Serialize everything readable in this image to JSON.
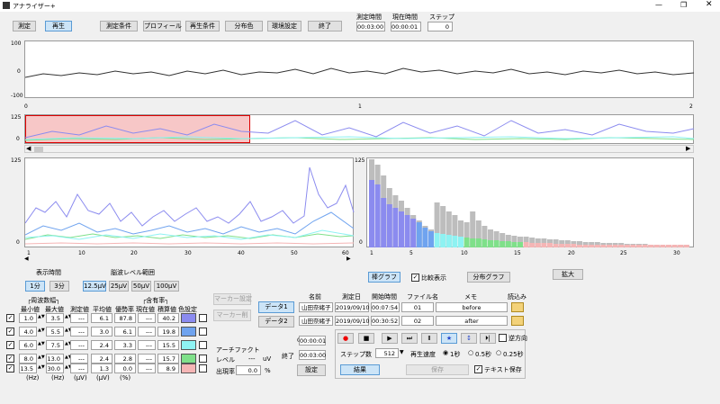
{
  "app": {
    "title": "アナライザー+"
  },
  "topbar": {
    "mode_measure": "測定",
    "mode_playback": "再生",
    "buttons": [
      "測定条件",
      "プロフィール",
      "再生条件",
      "分布色",
      "環境設定",
      "終了"
    ],
    "measure_time_label": "測定時間",
    "measure_time_value": "00:03:00",
    "current_time_label": "現在時間",
    "current_time_value": "00:00:01",
    "step_label": "ステップ",
    "step_value": "0"
  },
  "top_chart": {
    "y_ticks": [
      "100",
      "0",
      "-100"
    ],
    "x_ticks": [
      "0",
      "1",
      "2"
    ]
  },
  "overview_chart": {
    "y_ticks": [
      "125",
      "0"
    ]
  },
  "left_chart": {
    "y_ticks": [
      "125",
      "0"
    ],
    "x_ticks": [
      "1",
      "10",
      "20",
      "30",
      "40",
      "50",
      "60"
    ]
  },
  "right_chart": {
    "y_ticks": [
      "125",
      "0"
    ],
    "x_ticks": [
      "1",
      "5",
      "10",
      "15",
      "20",
      "25",
      "30"
    ]
  },
  "display_time": {
    "label": "表示時間",
    "options": [
      "1分",
      "3分"
    ]
  },
  "eeg_range": {
    "label": "脳波レベル範囲",
    "options": [
      "12.5μV",
      "25μV",
      "50μV",
      "100μV"
    ]
  },
  "freq_table": {
    "group_label": "┌周波数幅┐",
    "content_label": "┌含有率┐",
    "headers": [
      "最小値",
      "最大値",
      "測定値",
      "平均値",
      "優勢率",
      "現在値",
      "積算値",
      "色設定"
    ],
    "units": [
      "(Hz)",
      "(Hz)",
      "(μV)",
      "(μV)",
      "(%)"
    ],
    "rows": [
      {
        "min": "1.0",
        "max": "3.5",
        "measured": "---",
        "avg": "6.1",
        "dominance": "87.8",
        "current": "---",
        "cumulative": "40.2",
        "color": "#8b8bef"
      },
      {
        "min": "4.0",
        "max": "5.5",
        "measured": "---",
        "avg": "3.0",
        "dominance": "6.1",
        "current": "---",
        "cumulative": "19.8",
        "color": "#6fa3ef"
      },
      {
        "min": "6.0",
        "max": "7.5",
        "measured": "---",
        "avg": "2.4",
        "dominance": "3.3",
        "current": "---",
        "cumulative": "15.5",
        "color": "#8ef2f2"
      },
      {
        "min": "8.0",
        "max": "13.0",
        "measured": "---",
        "avg": "2.4",
        "dominance": "2.8",
        "current": "---",
        "cumulative": "15.7",
        "color": "#7fe08a"
      },
      {
        "min": "13.5",
        "max": "30.0",
        "measured": "---",
        "avg": "1.3",
        "dominance": "0.0",
        "current": "---",
        "cumulative": "8.9",
        "color": "#f5b5b5"
      }
    ]
  },
  "marker": {
    "set": "マーカー設定",
    "delete": "マーカー削"
  },
  "artifact": {
    "title": "アーチファクト",
    "level_label": "レベル",
    "level_value": "---",
    "level_unit": "uV",
    "rate_label": "出現率",
    "rate_value": "0.0",
    "rate_unit": "%"
  },
  "data_files": {
    "data1_button": "データ1",
    "data2_button": "データ2",
    "headers": [
      "名前",
      "測定日",
      "開始時間",
      "ファイル名",
      "メモ",
      "読込み"
    ],
    "rows": [
      {
        "name": "山田奈緒子",
        "date": "2019/09/10",
        "start": "00:07:54",
        "file": "01",
        "memo": "before"
      },
      {
        "name": "山田奈緒子",
        "date": "2019/09/10",
        "start": "00:30:52",
        "file": "02",
        "memo": "after"
      }
    ]
  },
  "graph_options": {
    "bar_graph": "棒グラフ",
    "compare": "比較表示",
    "dist_graph": "分布グラフ",
    "zoom": "拡大"
  },
  "range": {
    "start_label": "開始",
    "start_value": "00:00:01",
    "end_label": "終了",
    "end_value": "00:03:00",
    "settings": "設定"
  },
  "playback": {
    "reverse_label": "逆方向",
    "step_count_label": "ステップ数",
    "step_count_value": "512",
    "speed_label": "再生速度",
    "speed_options": [
      "1秒",
      "0.5秒",
      "0.25秒"
    ],
    "result": "結果",
    "save": "保存",
    "text_save": "テキスト保存"
  }
}
